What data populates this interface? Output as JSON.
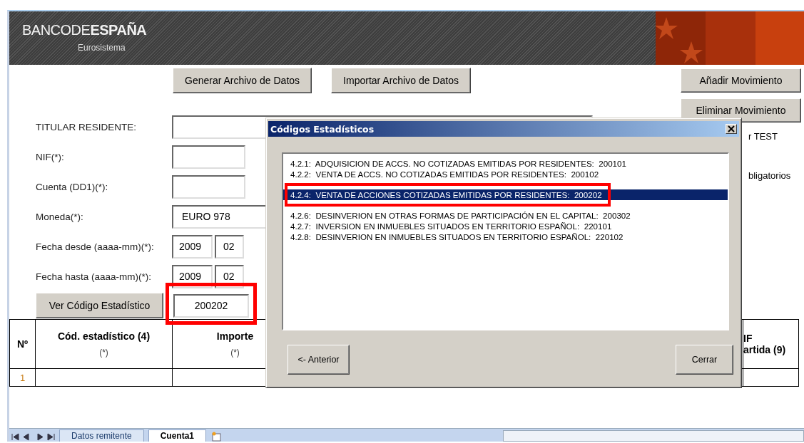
{
  "banner": {
    "logo": "BANCODE**ESPAÑA**",
    "subtitle": "Eurosistema"
  },
  "toolbar_buttons": [
    "Generar Archivo de Datos",
    "Importar Archivo de Datos"
  ],
  "side_buttons": [
    "Añadir Movimiento",
    "Eliminar Movimiento"
  ],
  "side_notes": [
    "r TEST",
    "bligatorios"
  ],
  "form": {
    "fields": [
      {
        "kind": "wide",
        "label": "TITULAR RESIDENTE:"
      },
      {
        "kind": "short",
        "label": "NIF(*):"
      },
      {
        "kind": "short",
        "label": "Cuenta (DD1)(*):"
      },
      {
        "kind": "wide",
        "label": "Moneda(*):",
        "value": "EURO 978"
      },
      {
        "kind": "date",
        "label": "Fecha desde (aaaa-mm)(*):",
        "year": "2009",
        "month": "02"
      },
      {
        "kind": "date",
        "label": "Fecha hasta (aaaa-mm)(*):",
        "year": "2009",
        "month": "02"
      }
    ],
    "code_button": "Ver Código Estadístico",
    "code_field": {
      "value": "200202",
      "highlighted": true
    }
  },
  "table": {
    "columns": [
      {
        "lines": [
          "Nº"
        ]
      },
      {
        "lines": [
          "Cód. estadístico (4)"
        ],
        "note": "(*)"
      },
      {
        "lines": [
          "Importe"
        ],
        "note": "(*)"
      },
      {
        "lines": [
          "IF",
          "artida (9)"
        ]
      }
    ],
    "rows": [
      {
        "number": "1"
      }
    ]
  },
  "sheet_tabs": [
    {
      "label": "Datos remitente",
      "selected": false
    },
    {
      "label": "Cuenta1",
      "selected": true
    }
  ],
  "dialog": {
    "title": "Códigos Estadísticos",
    "items": [
      {
        "text": "4.2.1:  ADQUISICION DE ACCS. NO COTIZADAS EMITIDAS POR RESIDENTES:  200101",
        "selected": false,
        "highlighted": false
      },
      {
        "text": "4.2.2:  VENTA DE ACCS. NO COTIZADAS EMITIDAS POR RESIDENTES:  200102",
        "selected": false,
        "highlighted": false
      },
      {
        "text": "4.2.4:  VENTA DE ACCIONES COTIZADAS EMITIDAS POR RESIDENTES:  200202",
        "selected": true,
        "highlighted": true
      },
      {
        "text": "4.2.6:  DESINVERION EN OTRAS FORMAS DE PARTICIPACIÓN EN EL CAPITAL:  200302",
        "selected": false,
        "highlighted": false
      },
      {
        "text": "4.2.7:  INVERSION EN INMUEBLES SITUADOS EN TERRITORIO ESPAÑOL:  220101",
        "selected": false,
        "highlighted": false
      },
      {
        "text": "4.2.8:  DESINVERION EN INMUEBLES SITUADOS EN TERRITORIO ESPAÑOL:  220102",
        "selected": false,
        "highlighted": false
      }
    ],
    "buttons": [
      "<- Anterior",
      "Cerrar"
    ]
  }
}
